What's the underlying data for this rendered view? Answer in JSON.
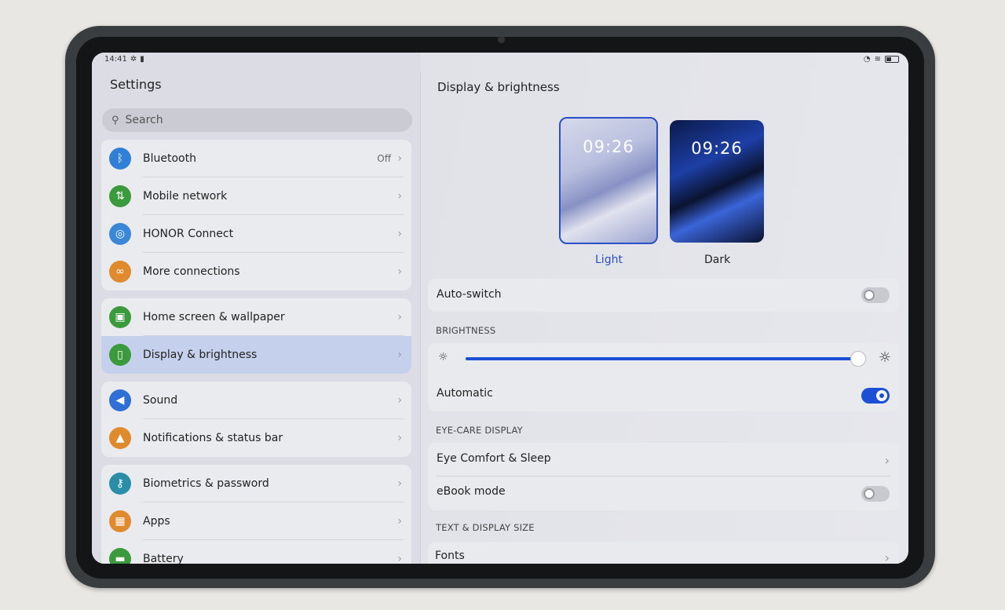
{
  "status": {
    "time": "14:41",
    "left_icons": [
      "gear-icon",
      "battery-saver-icon"
    ],
    "right_icons": [
      "speed-icon",
      "wifi-icon",
      "battery-icon"
    ]
  },
  "sidebar": {
    "title": "Settings",
    "search_placeholder": "Search",
    "groups": [
      [
        {
          "label": "Bluetooth",
          "value": "Off",
          "icon": "bluetooth-icon",
          "color": "#2f7fd6"
        },
        {
          "label": "Mobile network",
          "icon": "mobile-data-icon",
          "color": "#3a9a3c"
        },
        {
          "label": "HONOR Connect",
          "icon": "honor-connect-icon",
          "color": "#3a87d8"
        },
        {
          "label": "More connections",
          "icon": "link-icon",
          "color": "#e08a2e"
        }
      ],
      [
        {
          "label": "Home screen & wallpaper",
          "icon": "wallpaper-icon",
          "color": "#3a9a3c"
        },
        {
          "label": "Display & brightness",
          "icon": "display-icon",
          "color": "#3a9a3c",
          "selected": true
        }
      ],
      [
        {
          "label": "Sound",
          "icon": "speaker-icon",
          "color": "#2f6fd6"
        },
        {
          "label": "Notifications & status bar",
          "icon": "bell-icon",
          "color": "#e08a2e"
        }
      ],
      [
        {
          "label": "Biometrics & password",
          "icon": "key-icon",
          "color": "#2a8ea8"
        },
        {
          "label": "Apps",
          "icon": "apps-icon",
          "color": "#e08a2e"
        },
        {
          "label": "Battery",
          "icon": "battery-icon",
          "color": "#3a9a3c"
        }
      ]
    ]
  },
  "main": {
    "title": "Display & brightness",
    "themes": {
      "preview_time": "09:26",
      "light": "Light",
      "dark": "Dark",
      "selected": "Light",
      "accent": "#2a4fc8"
    },
    "auto_switch": {
      "label": "Auto-switch",
      "on": false
    },
    "brightness": {
      "section": "BRIGHTNESS",
      "level_percent": 100,
      "automatic_label": "Automatic",
      "automatic_on": true
    },
    "eye_care": {
      "section": "EYE-CARE DISPLAY",
      "eye_comfort": "Eye Comfort & Sleep",
      "ebook": "eBook mode",
      "ebook_on": false
    },
    "text_size": {
      "section": "TEXT & DISPLAY SIZE",
      "fonts": "Fonts"
    }
  }
}
